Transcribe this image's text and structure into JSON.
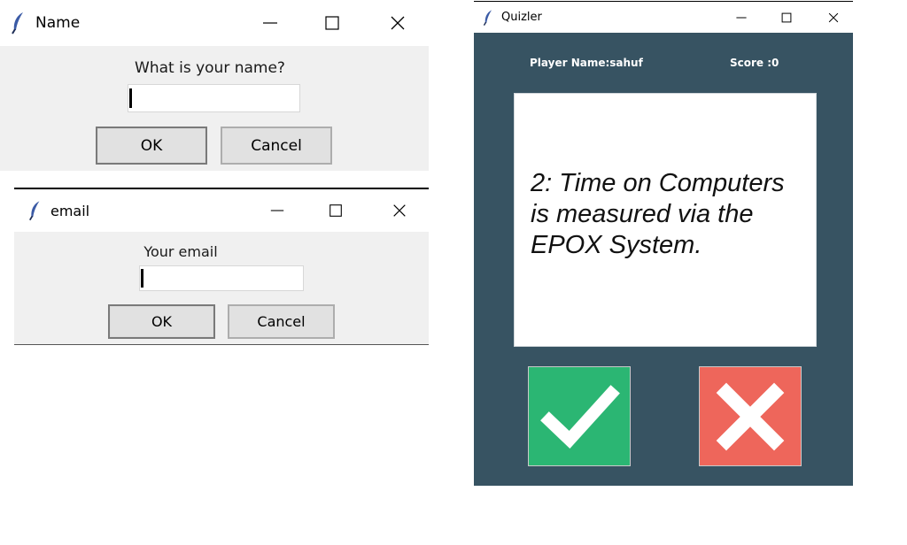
{
  "name_dialog": {
    "title": "Name",
    "prompt": "What is your name?",
    "input_value": "",
    "ok_label": "OK",
    "cancel_label": "Cancel"
  },
  "email_dialog": {
    "title": "email",
    "prompt": "Your email",
    "input_value": "",
    "ok_label": "OK",
    "cancel_label": "Cancel"
  },
  "quiz_window": {
    "title": "Quizler",
    "player_name": "Player Name:sahuf",
    "score": "Score :0",
    "question": "2: Time on Computers is measured via the EPOX System.",
    "true_icon": "check-icon",
    "false_icon": "cross-icon"
  },
  "icons": {
    "app_icon": "feather-icon",
    "minimize": "minimize-icon",
    "maximize": "maximize-icon",
    "close": "close-icon"
  },
  "colors": {
    "quiz_background": "#375362",
    "true_button": "#2bb673",
    "false_button": "#ee665b",
    "dialog_background": "#f0f0f0"
  }
}
